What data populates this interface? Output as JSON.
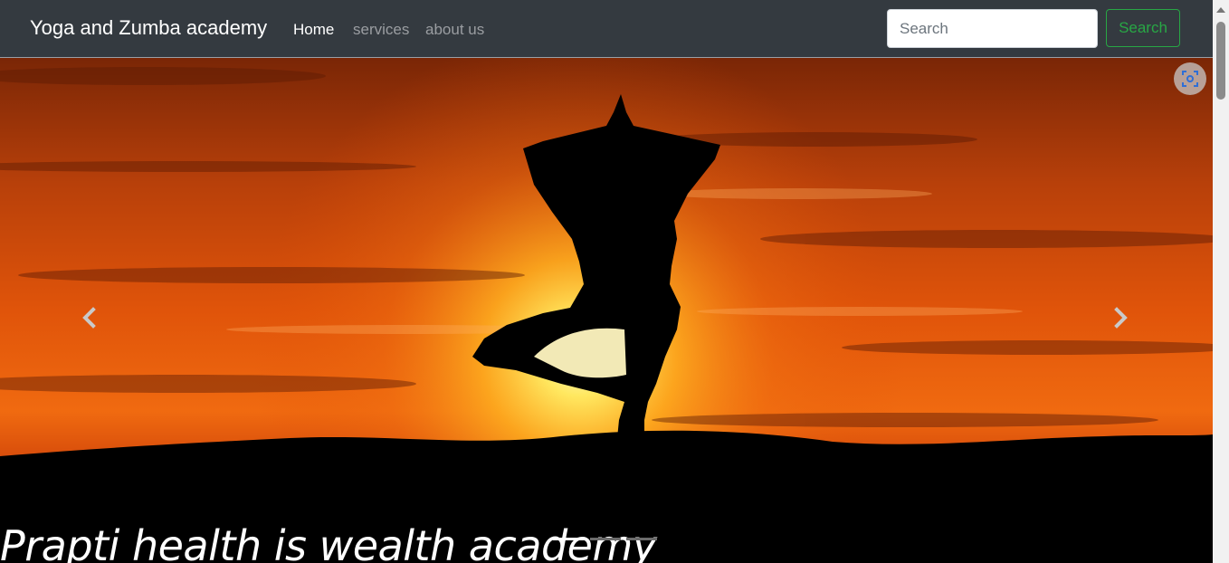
{
  "navbar": {
    "brand": "Yoga and Zumba academy",
    "links": [
      {
        "label": "Home",
        "active": true
      },
      {
        "label": "services",
        "active": false
      },
      {
        "label": "about us",
        "active": false
      }
    ],
    "search": {
      "placeholder": "Search",
      "button_label": "Search"
    }
  },
  "carousel": {
    "caption": "Prapti health is wealth academy",
    "indicators": {
      "count": 3,
      "active_index": 0
    },
    "controls": {
      "prev_icon": "chevron-left-icon",
      "next_icon": "chevron-right-icon"
    }
  },
  "colors": {
    "navbar_bg": "#343a40",
    "success": "#28a745",
    "sky_top": "#8a2a06",
    "sky_mid": "#e85a08",
    "sun": "#fff3a0"
  },
  "overlay": {
    "icon": "screenshot-lens-icon"
  }
}
